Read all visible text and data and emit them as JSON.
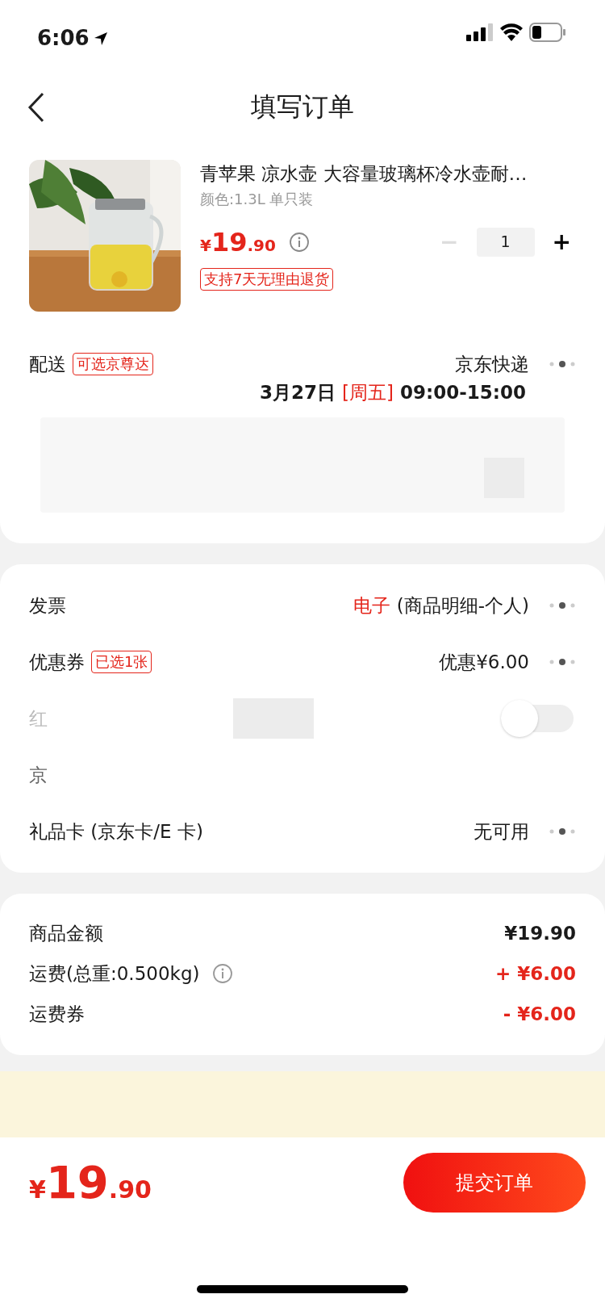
{
  "status_bar": {
    "time": "6:06"
  },
  "header": {
    "title": "填写订单"
  },
  "product": {
    "title": "青苹果 凉水壶 大容量玻璃杯冷水壶耐…",
    "spec": "颜色:1.3L 单只装",
    "price": {
      "symbol": "¥",
      "integer": "19",
      "decimal": ".90"
    },
    "decrease": "−",
    "decrease_disabled": true,
    "quantity": "1",
    "increase": "+",
    "tag": "支持7天无理由退货"
  },
  "delivery": {
    "label": "配送",
    "tag": "可选京尊达",
    "carrier": "京东快递",
    "date": "3月27日",
    "weekday": "[周五]",
    "time": "09:00-15:00"
  },
  "options": [
    {
      "kind": "link",
      "label": "发票",
      "highlight": "电子",
      "value": "(商品明细-个人)"
    },
    {
      "kind": "link",
      "label": "优惠券",
      "tag": "已选1张",
      "value": "优惠¥6.00"
    },
    {
      "kind": "toggle",
      "label": "红",
      "on": false
    },
    {
      "kind": "plain",
      "label": "京"
    },
    {
      "kind": "link",
      "label": "礼品卡 (京东卡/E 卡)",
      "value": "无可用"
    }
  ],
  "summary": [
    {
      "label": "商品金额",
      "value": "¥19.90",
      "kind": "normal"
    },
    {
      "label": "运费(总重:0.500kg)",
      "info": true,
      "value": "+ ¥6.00",
      "kind": "red"
    },
    {
      "label": "运费券",
      "value": "- ¥6.00",
      "kind": "red"
    }
  ],
  "footer": {
    "total": {
      "symbol": "¥",
      "integer": "19",
      "decimal": ".90"
    },
    "submit": "提交订单"
  }
}
